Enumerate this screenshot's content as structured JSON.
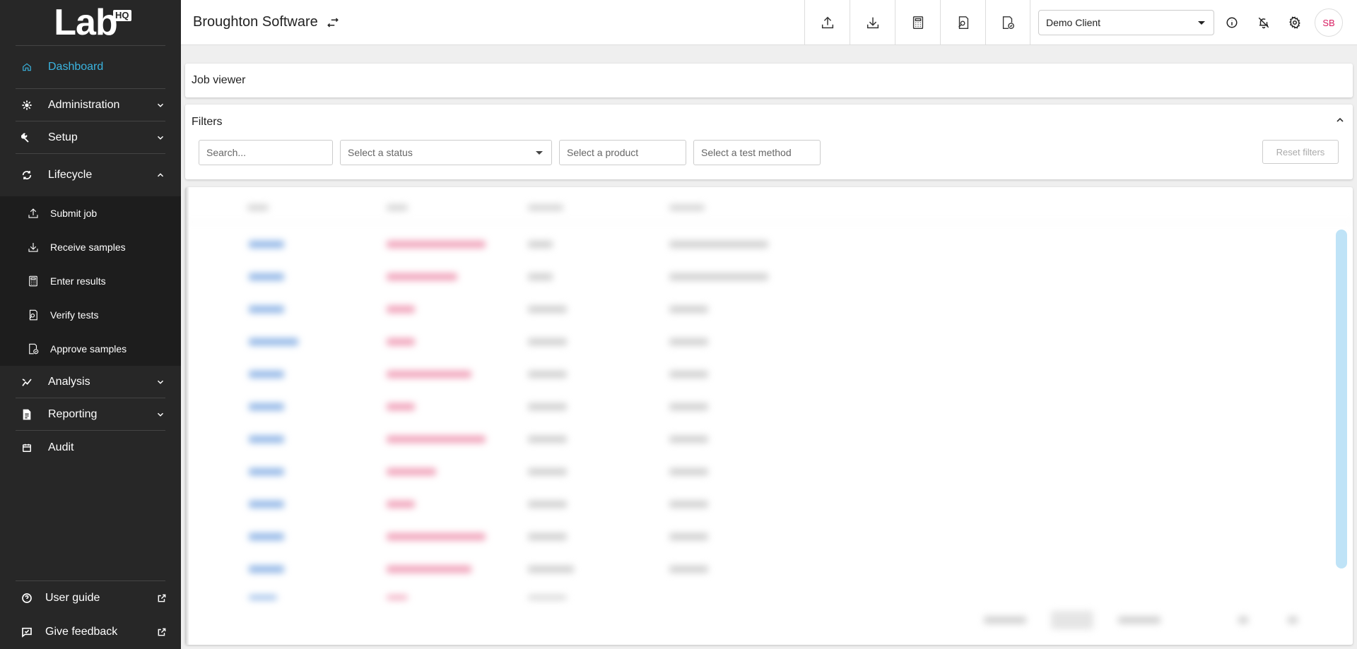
{
  "sidebar": {
    "logo": {
      "text": "Lab",
      "badge": "HQ"
    },
    "dashboard": "Dashboard",
    "administration": "Administration",
    "setup": "Setup",
    "lifecycle": "Lifecycle",
    "lifecycle_items": [
      {
        "label": "Submit job",
        "icon": "upload-icon"
      },
      {
        "label": "Receive samples",
        "icon": "download-icon"
      },
      {
        "label": "Enter results",
        "icon": "calculator-icon"
      },
      {
        "label": "Verify tests",
        "icon": "document-search-icon"
      },
      {
        "label": "Approve samples",
        "icon": "document-check-icon"
      }
    ],
    "analysis": "Analysis",
    "reporting": "Reporting",
    "audit": "Audit",
    "user_guide": "User guide",
    "give_feedback": "Give feedback"
  },
  "topbar": {
    "org_title": "Broughton Software",
    "client": "Demo Client",
    "avatar_initials": "SB"
  },
  "content": {
    "job_viewer_title": "Job viewer",
    "filters_title": "Filters",
    "search_placeholder": "Search...",
    "status_placeholder": "Select a status",
    "product_placeholder": "Select a product",
    "method_placeholder": "Select a test method",
    "reset_filters": "Reset filters"
  },
  "colors": {
    "sidebar_bg": "#272727",
    "accent": "#3ab4e0",
    "avatar_text": "#d81b60"
  }
}
